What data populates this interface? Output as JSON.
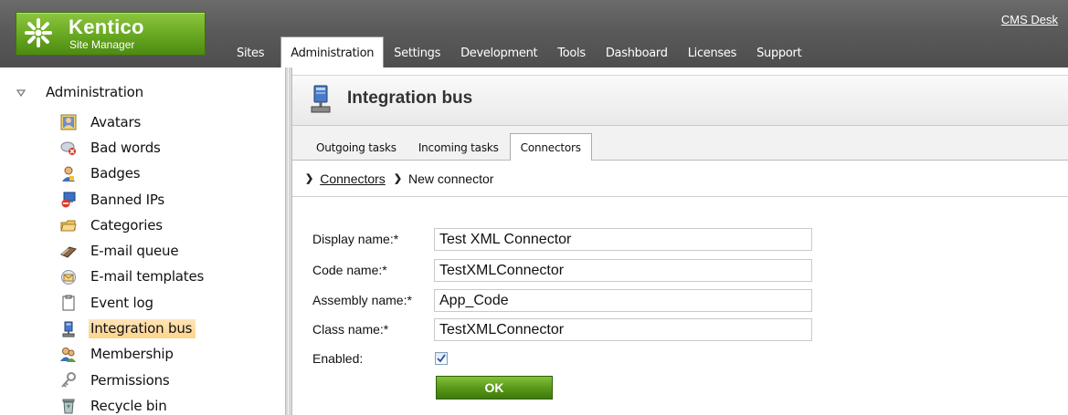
{
  "header": {
    "logo": {
      "name": "Kentico",
      "subtitle": "Site Manager"
    },
    "cms_desk_link": "CMS Desk",
    "tabs": [
      {
        "label": "Sites"
      },
      {
        "label": "Administration"
      },
      {
        "label": "Settings"
      },
      {
        "label": "Development"
      },
      {
        "label": "Tools"
      },
      {
        "label": "Dashboard"
      },
      {
        "label": "Licenses"
      },
      {
        "label": "Support"
      }
    ],
    "active_tab": "Administration"
  },
  "sidebar": {
    "root_label": "Administration",
    "items": [
      {
        "label": "Avatars",
        "icon": "avatars-icon"
      },
      {
        "label": "Bad words",
        "icon": "bad-words-icon"
      },
      {
        "label": "Badges",
        "icon": "badges-icon"
      },
      {
        "label": "Banned IPs",
        "icon": "banned-ips-icon"
      },
      {
        "label": "Categories",
        "icon": "categories-icon"
      },
      {
        "label": "E-mail queue",
        "icon": "email-queue-icon"
      },
      {
        "label": "E-mail templates",
        "icon": "email-templates-icon"
      },
      {
        "label": "Event log",
        "icon": "event-log-icon"
      },
      {
        "label": "Integration bus",
        "icon": "integration-bus-icon"
      },
      {
        "label": "Membership",
        "icon": "membership-icon"
      },
      {
        "label": "Permissions",
        "icon": "permissions-icon"
      },
      {
        "label": "Recycle bin",
        "icon": "recycle-bin-icon"
      }
    ],
    "selected": "Integration bus"
  },
  "main": {
    "title": "Integration bus",
    "subtabs": [
      {
        "label": "Outgoing tasks"
      },
      {
        "label": "Incoming tasks"
      },
      {
        "label": "Connectors"
      }
    ],
    "active_subtab": "Connectors",
    "breadcrumb": {
      "link": "Connectors",
      "current": "New connector"
    },
    "form": {
      "display_name_label": "Display name:*",
      "display_name_value": "Test XML Connector",
      "code_name_label": "Code name:*",
      "code_name_value": "TestXMLConnector",
      "assembly_name_label": "Assembly name:*",
      "assembly_name_value": "App_Code",
      "class_name_label": "Class name:*",
      "class_name_value": "TestXMLConnector",
      "enabled_label": "Enabled:",
      "enabled": true,
      "ok_label": "OK"
    }
  },
  "colors": {
    "header_bg": "#5a5a5a",
    "logo_green": "#6aaa22",
    "selection_orange": "#ffd48c",
    "button_green": "#5a9a1a"
  }
}
